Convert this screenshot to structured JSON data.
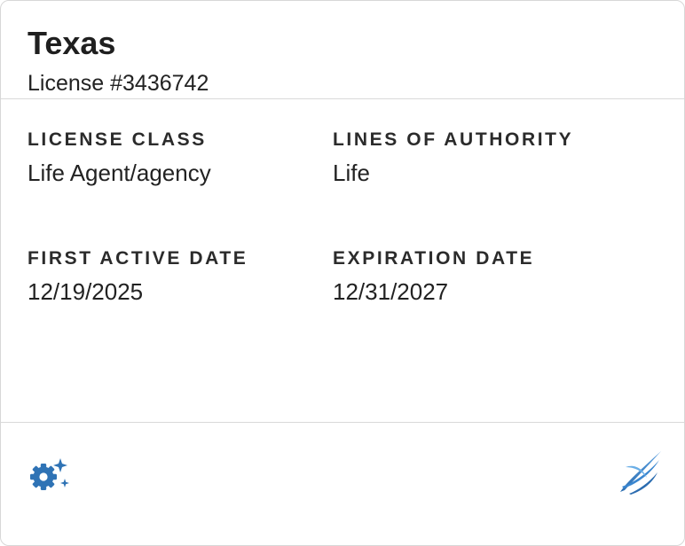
{
  "card": {
    "title": "Texas",
    "subtitle": "License #3436742"
  },
  "fields": {
    "license_class": {
      "label": "LICENSE CLASS",
      "value": "Life Agent/agency"
    },
    "lines_of_authority": {
      "label": "LINES OF AUTHORITY",
      "value": "Life"
    },
    "first_active_date": {
      "label": "FIRST ACTIVE DATE",
      "value": "12/19/2025"
    },
    "expiration_date": {
      "label": "EXPIRATION DATE",
      "value": "12/31/2027"
    }
  },
  "footer": {
    "settings_icon": "gear-sparkle-icon",
    "logo_icon": "swoosh-logo-icon"
  },
  "colors": {
    "accent": "#2f73b5",
    "divider": "#d9d9d9",
    "text": "#212121"
  }
}
